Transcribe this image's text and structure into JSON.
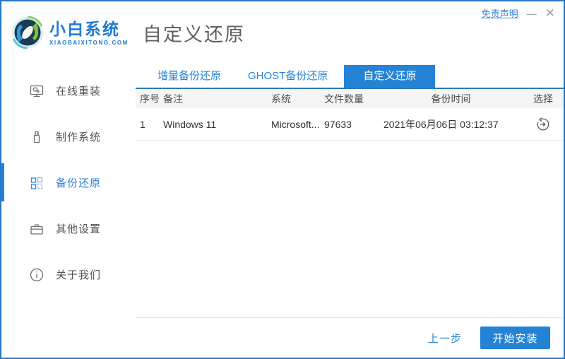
{
  "window": {
    "disclaimer": "免责声明",
    "minimize": "—",
    "close": "✕"
  },
  "brand": {
    "name": "小白系统",
    "domain": "XIAOBAIXITONG.COM",
    "logo_icon": "sync-arrows-logo"
  },
  "page_title": "自定义还原",
  "sidebar": {
    "items": [
      {
        "label": "在线重装",
        "icon": "monitor-icon",
        "active": false
      },
      {
        "label": "制作系统",
        "icon": "usb-drive-icon",
        "active": false
      },
      {
        "label": "备份还原",
        "icon": "grid-squares-icon",
        "active": true
      },
      {
        "label": "其他设置",
        "icon": "briefcase-icon",
        "active": false
      },
      {
        "label": "关于我们",
        "icon": "info-circle-icon",
        "active": false
      }
    ]
  },
  "tabs": [
    {
      "label": "增量备份还原",
      "active": false
    },
    {
      "label": "GHOST备份还原",
      "active": false
    },
    {
      "label": "自定义还原",
      "active": true
    }
  ],
  "table": {
    "headers": [
      "序号",
      "备注",
      "系统",
      "文件数量",
      "备份时间",
      "选择"
    ],
    "rows": [
      {
        "index": "1",
        "note": "Windows 11",
        "system": "Microsoft...",
        "file_count": "97633",
        "backup_time": "2021年06月06日 03:12:37",
        "action_icon": "restore-icon"
      }
    ]
  },
  "footer": {
    "back_label": "上一步",
    "install_label": "开始安装"
  },
  "colors": {
    "accent_blue": "#2583d6",
    "window_border": "#2577c8",
    "tab_underline": "#2a7ab9",
    "table_header_bg": "#f5f5f5",
    "link_blue": "#4287d3",
    "brand_blue": "#1d7ad6",
    "logo_green": "#7cc142",
    "logo_dark": "#1b3c52"
  }
}
